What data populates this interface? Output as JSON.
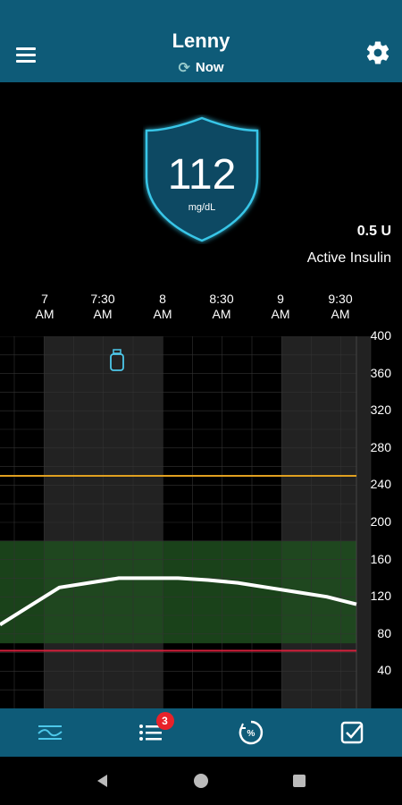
{
  "header": {
    "title": "Lenny",
    "status": "Now"
  },
  "reading": {
    "value": "112",
    "unit": "mg/dL"
  },
  "insulin": {
    "value": "0.5 U",
    "label": "Active Insulin"
  },
  "colors": {
    "header_bg": "#0e5b78",
    "target_band": "#1e4d1e",
    "high_line": "#e0a020",
    "low_line": "#d6203c",
    "glucose_line": "#ffffff",
    "badge": "#e8222a"
  },
  "chart_data": {
    "type": "line",
    "x_labels": [
      "7\nAM",
      "7:30\nAM",
      "8\nAM",
      "8:30\nAM",
      "9\nAM",
      "9:30\nAM"
    ],
    "x": [
      "6:45",
      "7:00",
      "7:15",
      "7:30",
      "7:45",
      "8:00",
      "8:15",
      "8:30",
      "8:45",
      "9:00",
      "9:15",
      "9:30",
      "9:45"
    ],
    "values": [
      90,
      110,
      130,
      135,
      140,
      140,
      140,
      138,
      135,
      130,
      125,
      120,
      112
    ],
    "ylim": [
      0,
      400
    ],
    "yticks": [
      40,
      80,
      120,
      160,
      200,
      240,
      280,
      320,
      360,
      400
    ],
    "target_range": [
      70,
      180
    ],
    "high_threshold": 250,
    "low_threshold": 62,
    "event_icon": "insulin-vial-icon",
    "grid": true
  },
  "bottom_nav": {
    "tabs": [
      {
        "name": "trend-icon",
        "active": true
      },
      {
        "name": "list-icon",
        "active": false,
        "badge": "3"
      },
      {
        "name": "percent-time-icon",
        "active": false
      },
      {
        "name": "checklist-icon",
        "active": false
      }
    ]
  }
}
